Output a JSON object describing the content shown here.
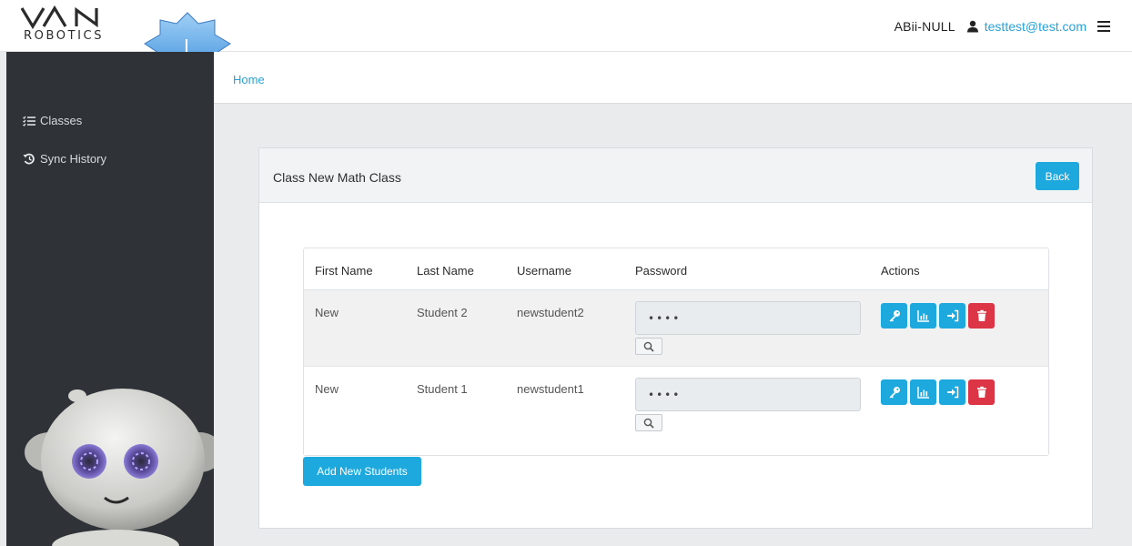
{
  "brand": {
    "logo_text": "ROBOTICS",
    "logo_mark": "VAN"
  },
  "badge": {
    "letter": "I"
  },
  "header": {
    "org_name": "ABii-NULL",
    "user_email": "testtest@test.com",
    "user_icon": "user-icon",
    "menu_icon": "hamburger-menu-icon"
  },
  "sidebar": {
    "items": [
      {
        "label": "Classes",
        "icon": "list-icon"
      },
      {
        "label": "Sync History",
        "icon": "history-icon"
      }
    ]
  },
  "breadcrumb": {
    "home": "Home"
  },
  "card": {
    "title": "Class New Math Class",
    "back_label": "Back",
    "add_label": "Add New Students"
  },
  "table": {
    "headers": [
      "First Name",
      "Last Name",
      "Username",
      "Password",
      "Actions"
    ],
    "rows": [
      {
        "first": "New",
        "last": "Student 2",
        "username": "newstudent2",
        "password": "••••"
      },
      {
        "first": "New",
        "last": "Student 1",
        "username": "newstudent1",
        "password": "••••"
      }
    ],
    "action_icons": [
      "key-icon",
      "chart-icon",
      "sign-in-icon",
      "trash-icon"
    ]
  },
  "colors": {
    "accent": "#1ea9de",
    "danger": "#dc3545",
    "sidebar": "#2f3337",
    "link": "#27a3d8"
  }
}
